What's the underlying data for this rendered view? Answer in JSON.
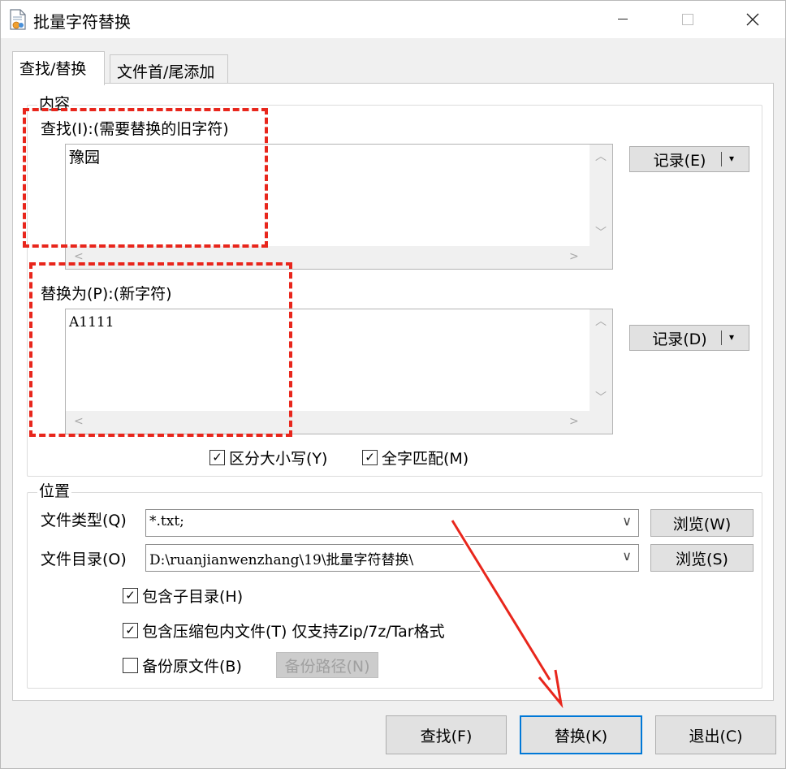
{
  "window": {
    "title": "批量字符替换",
    "controls": {
      "minimize": "—",
      "maximize": "☐",
      "close": "✕"
    }
  },
  "tabs": [
    {
      "label": "查找/替换",
      "active": true
    },
    {
      "label": "文件首/尾添加",
      "active": false
    }
  ],
  "content_group": {
    "label": "内容",
    "find": {
      "label": "查找(I):(需要替换的旧字符)",
      "value": "豫园",
      "history_button": "记录(E)"
    },
    "replace": {
      "label": "替换为(P):(新字符)",
      "value": "A1111",
      "history_button": "记录(D)"
    },
    "options": [
      {
        "label": "区分大小写(Y)",
        "checked": true
      },
      {
        "label": "全字匹配(M)",
        "checked": true
      }
    ]
  },
  "location_group": {
    "label": "位置",
    "file_type": {
      "label": "文件类型(Q)",
      "value": "*.txt;",
      "browse": "浏览(W)"
    },
    "file_dir": {
      "label": "文件目录(O)",
      "value": "D:\\ruanjianwenzhang\\19\\批量字符替换\\",
      "browse": "浏览(S)"
    },
    "include_subdirs": {
      "label": "包含子目录(H)",
      "checked": true
    },
    "include_archives": {
      "label": "包含压缩包内文件(T) 仅支持Zip/7z/Tar格式",
      "checked": true
    },
    "backup": {
      "label": "备份原文件(B)",
      "checked": false,
      "path_button": "备份路径(N)"
    }
  },
  "footer": {
    "find": "查找(F)",
    "replace": "替换(K)",
    "exit": "退出(C)"
  },
  "icons": {
    "check": "✓",
    "dropdown": "▾",
    "chevron_down": "∨",
    "scroll_up": "︿",
    "scroll_down": "﹀",
    "scroll_left": "<",
    "scroll_right": ">"
  },
  "colors": {
    "annotation": "#e8261c",
    "focus_border": "#0078d7"
  }
}
